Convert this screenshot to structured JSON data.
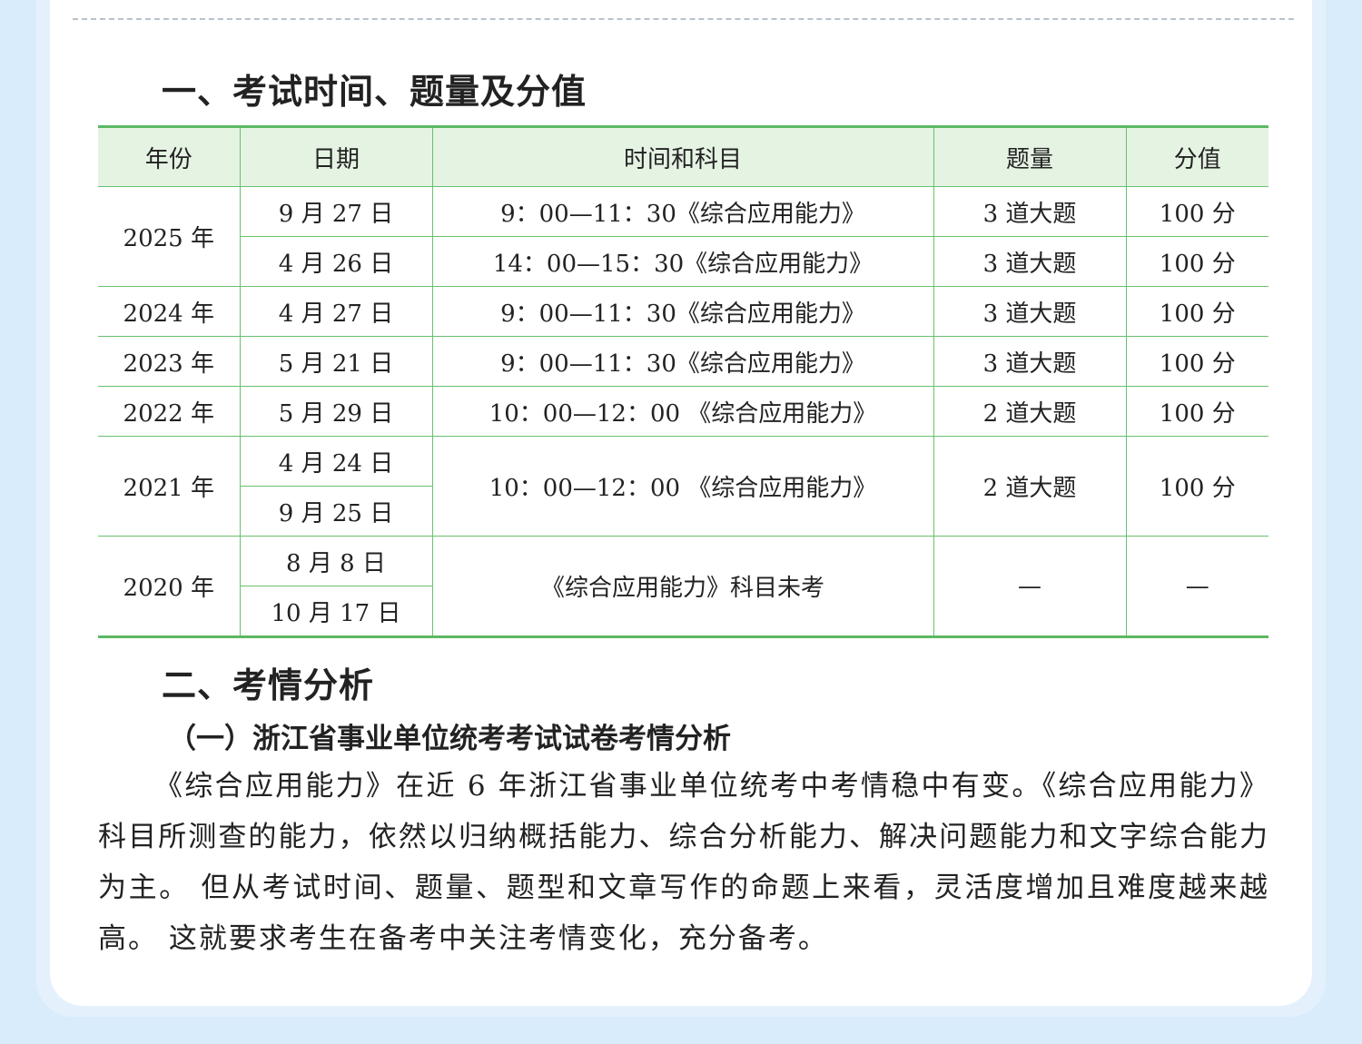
{
  "section1": {
    "title": "一、考试时间、题量及分值"
  },
  "table": {
    "headers": [
      "年份",
      "日期",
      "时间和科目",
      "题量",
      "分值"
    ],
    "rows": [
      {
        "year": "2025 年",
        "dates": [
          "9 月 27 日",
          "4 月 26 日"
        ],
        "time_subject": [
          "9：00—11：30《综合应用能力》",
          "14：00—15：30《综合应用能力》"
        ],
        "questions": [
          "3 道大题",
          "3 道大题"
        ],
        "score": [
          "100 分",
          "100 分"
        ]
      },
      {
        "year": "2024 年",
        "dates": [
          "4 月 27 日"
        ],
        "time_subject": [
          "9：00—11：30《综合应用能力》"
        ],
        "questions": [
          "3 道大题"
        ],
        "score": [
          "100 分"
        ]
      },
      {
        "year": "2023 年",
        "dates": [
          "5 月 21 日"
        ],
        "time_subject": [
          "9：00—11：30《综合应用能力》"
        ],
        "questions": [
          "3 道大题"
        ],
        "score": [
          "100 分"
        ]
      },
      {
        "year": "2022 年",
        "dates": [
          "5 月 29 日"
        ],
        "time_subject": [
          "10：00—12：00 《综合应用能力》"
        ],
        "questions": [
          "2 道大题"
        ],
        "score": [
          "100 分"
        ]
      },
      {
        "year": "2021 年",
        "dates": [
          "4 月 24 日",
          "9 月 25 日"
        ],
        "time_subject": [
          "10：00—12：00 《综合应用能力》"
        ],
        "questions": [
          "2 道大题"
        ],
        "score": [
          "100 分"
        ]
      },
      {
        "year": "2020 年",
        "dates": [
          "8 月 8 日",
          "10 月 17 日"
        ],
        "time_subject": [
          "《综合应用能力》科目未考"
        ],
        "questions": [
          "—"
        ],
        "score": [
          "—"
        ]
      }
    ]
  },
  "section2": {
    "title": "二、考情分析",
    "subtitle": "（一）浙江省事业单位统考考试试卷考情分析",
    "paragraph": "《综合应用能力》在近 6 年浙江省事业单位统考中考情稳中有变。《综合应用能力》科目所测查的能力，依然以归纳概括能力、综合分析能力、解决问题能力和文字综合能力为主。 但从考试时间、题量、题型和文章写作的命题上来看，灵活度增加且难度越来越高。 这就要求考生在备考中关注考情变化，充分备考。"
  },
  "colors": {
    "table_border": "#5cb862",
    "table_header_bg": "#e5f3e3",
    "page_bg": "#d9ecfb"
  }
}
